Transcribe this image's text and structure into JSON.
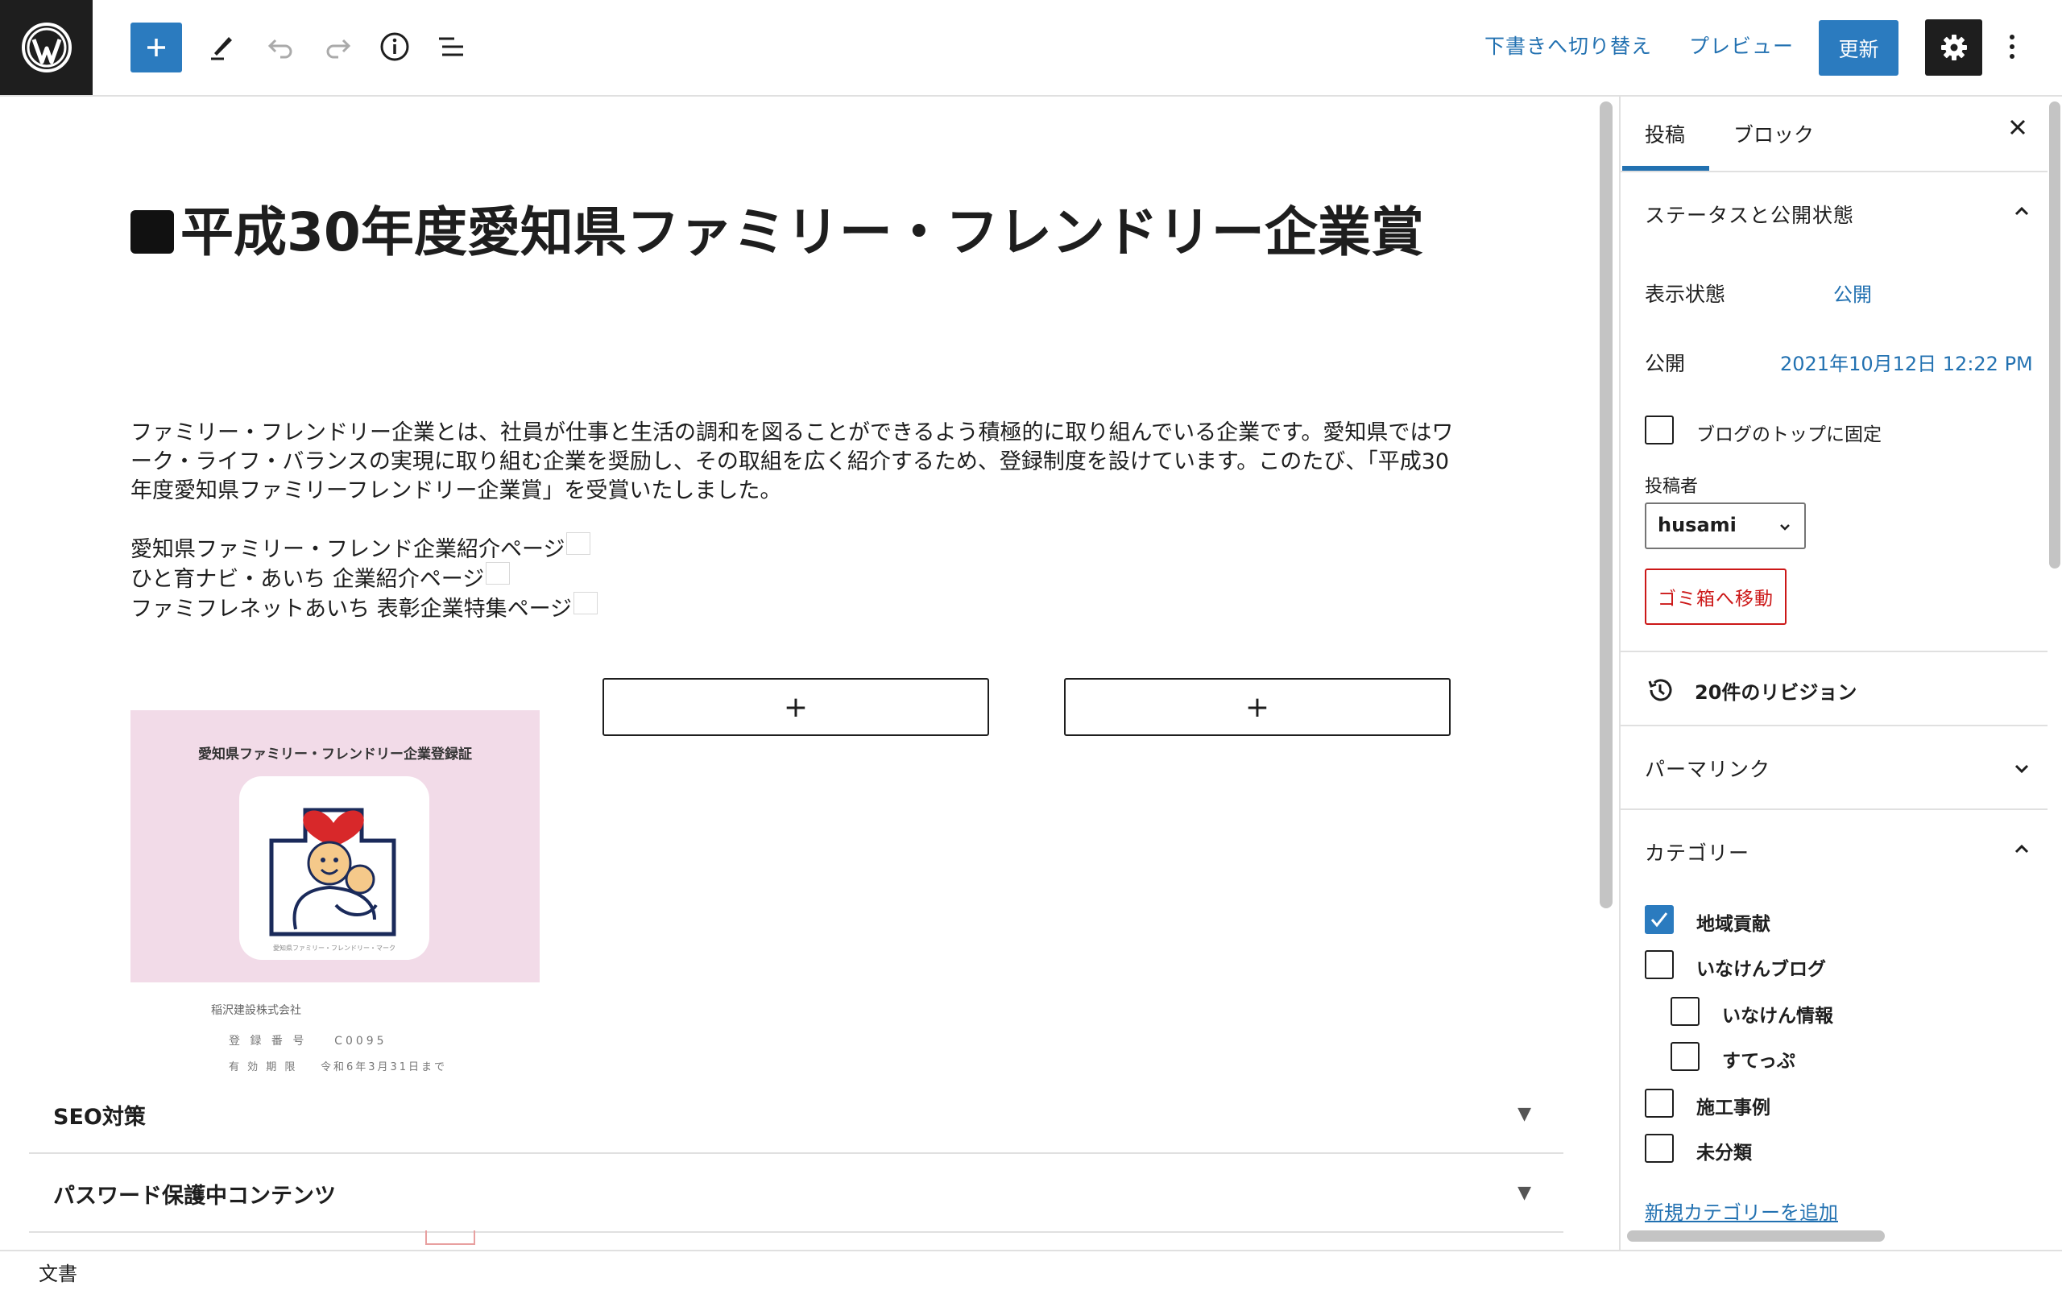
{
  "toolbar": {
    "switch_to_draft": "下書きへ切り替え",
    "preview": "プレビュー",
    "update": "更新"
  },
  "post": {
    "title": "■平成30年度愛知県ファミリー・フレンドリー企業賞",
    "intro": "ファミリー・フレンドリー企業とは、社員が仕事と生活の調和を図ることができるよう積極的に取り組んでいる企業です。愛知県ではワーク・ライフ・バランスの実現に取り組む企業を奨励し、その取組を広く紹介するため、登録制度を設けています。このたび、「平成30年度愛知県ファミリーフレンドリー企業賞」を受賞いたしました。",
    "links": [
      "愛知県ファミリー・フレンド企業紹介ページ",
      "ひと育ナビ・あいち 企業紹介ページ",
      "ファミフレネットあいち 表彰企業特集ページ"
    ],
    "appender_symbol": "+",
    "certificate": {
      "heading": "愛知県ファミリー・フレンドリー企業登録証",
      "company": "稲沢建設株式会社",
      "reg_label": "登 録 番 号",
      "reg_value": "C0095",
      "valid_label": "有 効 期 限",
      "valid_value": "令和6年3月31日まで",
      "logo_caption": "愛知県ファミリー・フレンドリー・マーク"
    }
  },
  "meta_boxes": [
    {
      "label": "SEO対策"
    },
    {
      "label": "パスワード保護中コンテンツ"
    }
  ],
  "sidebar": {
    "tabs": [
      "投稿",
      "ブロック"
    ],
    "status_panel": {
      "title": "ステータスと公開状態",
      "visibility_label": "表示状態",
      "visibility_value": "公開",
      "publish_label": "公開",
      "publish_value": "2021年10月12日 12:22 PM",
      "sticky_label": "ブログのトップに固定",
      "author_label": "投稿者",
      "author_value": "husami",
      "trash": "ゴミ箱へ移動"
    },
    "revisions": "20件のリビジョン",
    "permalink": "パーマリンク",
    "categories": {
      "title": "カテゴリー",
      "items": [
        {
          "label": "地域貢献",
          "checked": true
        },
        {
          "label": "いなけんブログ",
          "checked": false
        },
        {
          "label": "いなけん情報",
          "checked": false
        },
        {
          "label": "すてっぷ",
          "checked": false
        },
        {
          "label": "施工事例",
          "checked": false
        },
        {
          "label": "未分類",
          "checked": false
        }
      ],
      "add_new": "新規カテゴリーを追加"
    }
  },
  "footer": {
    "breadcrumb": "文書"
  },
  "colors": {
    "accent": "#2271b1",
    "primary_button": "#2b7bbf",
    "danger": "#cc1818",
    "dark": "#1e1e1e"
  }
}
